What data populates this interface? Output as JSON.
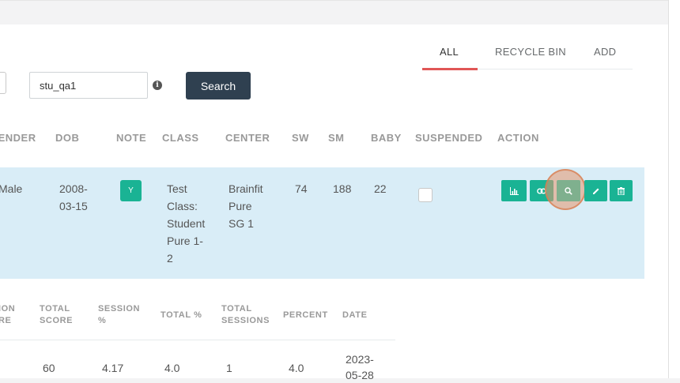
{
  "tabs": [
    {
      "label": "ALL",
      "active": true
    },
    {
      "label": "RECYCLE BIN",
      "active": false
    },
    {
      "label": "ADD",
      "active": false
    }
  ],
  "search": {
    "value": "stu_qa1",
    "info_icon": "info-circle-icon",
    "button_label": "Search"
  },
  "table": {
    "headers": {
      "gender": "GENDER",
      "dob": "DOB",
      "note": "NOTE",
      "class": "CLASS",
      "center": "CENTER",
      "sw": "SW",
      "sm": "SM",
      "baby": "BABY",
      "suspended": "SUSPENDED",
      "action": "ACTION"
    },
    "row": {
      "gender": "Male",
      "dob_line1": "2008-",
      "dob_line2": "03-15",
      "note": "Y",
      "class_lines": [
        "Test",
        "Class:",
        "Student",
        "Pure 1-",
        "2"
      ],
      "center_lines": [
        "Brainfit",
        "Pure",
        "SG 1"
      ],
      "sw": "74",
      "sm": "188",
      "baby": "22",
      "suspended": false,
      "actions": [
        "bar-chart-icon",
        "link-icon",
        "search-icon",
        "pencil-icon",
        "trash-icon"
      ]
    }
  },
  "subtable": {
    "headers": {
      "session_score_line1": "ION",
      "session_score_line2": "RE",
      "total_score_line1": "TOTAL",
      "total_score_line2": "SCORE",
      "session_pct_line1": "SESSION",
      "session_pct_line2": "%",
      "total_pct": "TOTAL %",
      "total_sessions_line1": "TOTAL",
      "total_sessions_line2": "SESSIONS",
      "percent": "PERCENT",
      "date": "DATE"
    },
    "row": {
      "total_score": "60",
      "session_pct": "4.17",
      "total_pct": "4.0",
      "total_sessions": "1",
      "percent": "4.0",
      "date_line1": "2023-",
      "date_line2": "05-28"
    }
  },
  "colors": {
    "accent": "#1ab394",
    "tab_underline": "#e05656",
    "search_button": "#2f4050",
    "row_highlight": "#d9edf7"
  }
}
